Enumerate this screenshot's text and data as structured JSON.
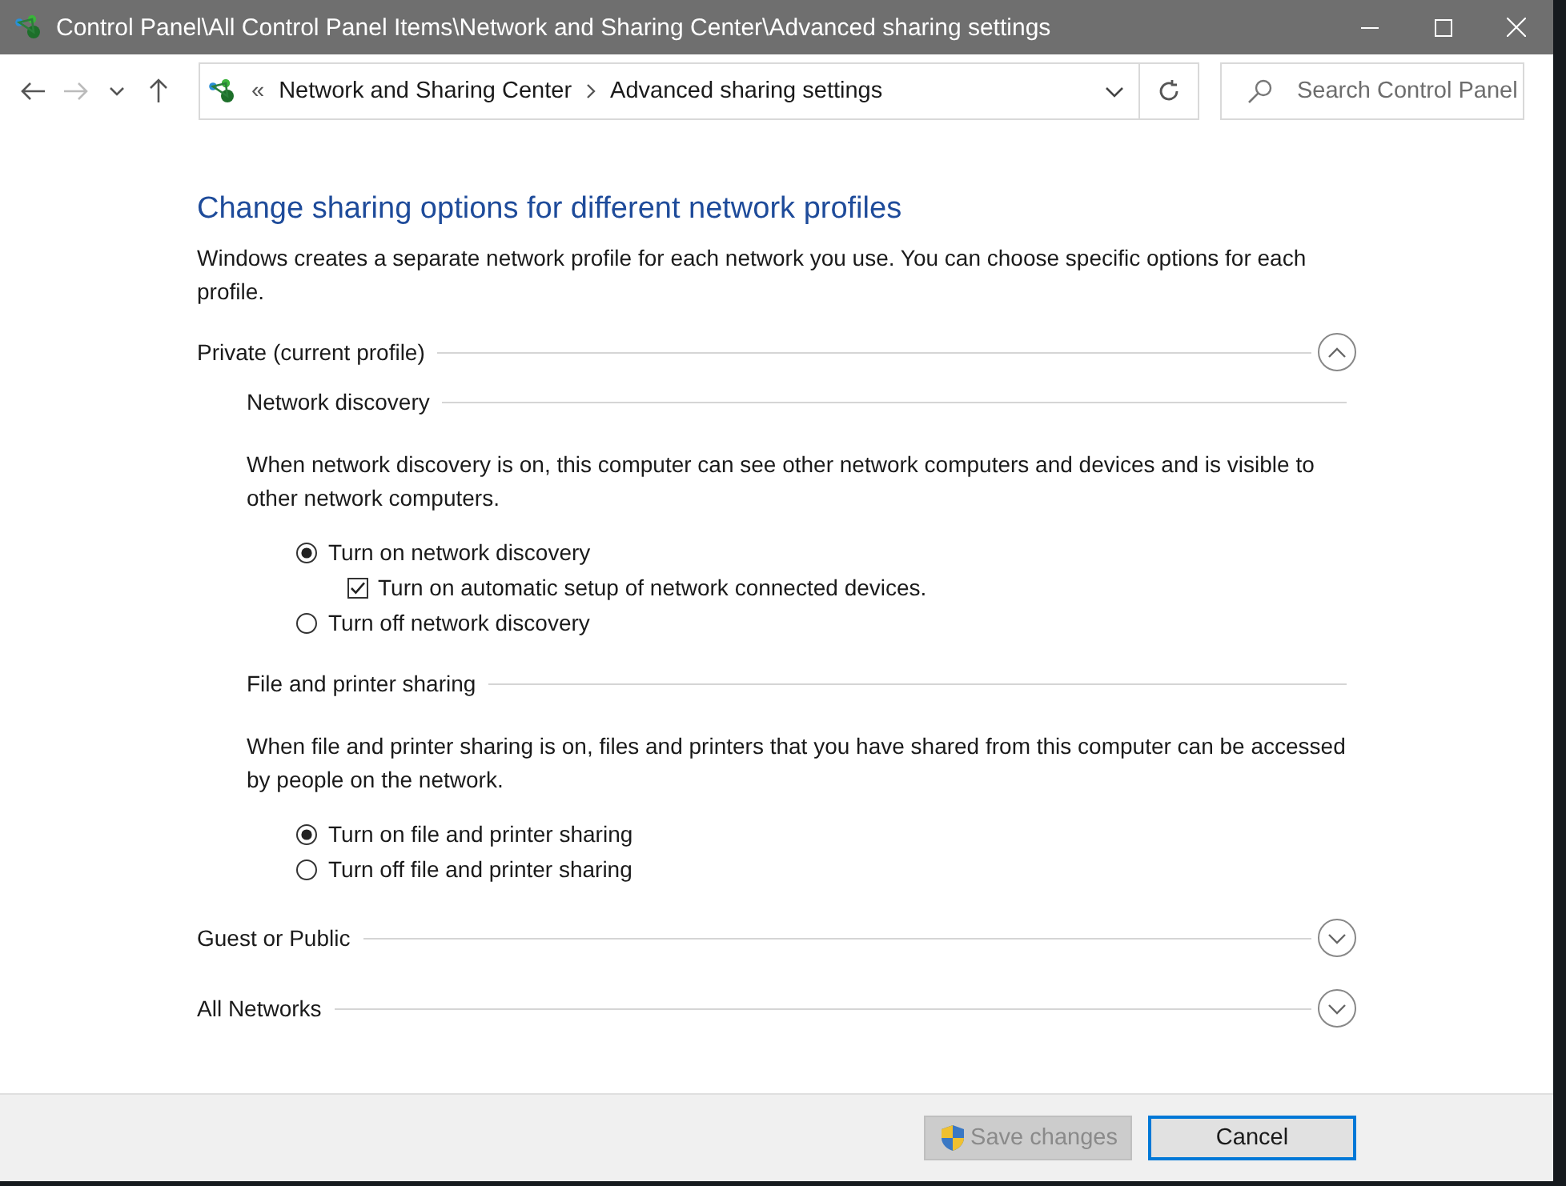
{
  "window": {
    "title": "Control Panel\\All Control Panel Items\\Network and Sharing Center\\Advanced sharing settings"
  },
  "address_bar": {
    "overflow": "«",
    "breadcrumbs": [
      "Network and Sharing Center",
      "Advanced sharing settings"
    ]
  },
  "search": {
    "placeholder": "Search Control Panel"
  },
  "heading": "Change sharing options for different network profiles",
  "intro": "Windows creates a separate network profile for each network you use. You can choose specific options for each profile.",
  "profiles": [
    {
      "name": "Private (current profile)",
      "expanded": true,
      "sections": [
        {
          "title": "Network discovery",
          "description": "When network discovery is on, this computer can see other network computers and devices and is visible to other network computers.",
          "options": [
            {
              "kind": "radio",
              "label": "Turn on network discovery",
              "selected": true
            },
            {
              "kind": "checkbox",
              "label": "Turn on automatic setup of network connected devices.",
              "checked": true
            },
            {
              "kind": "radio",
              "label": "Turn off network discovery",
              "selected": false
            }
          ]
        },
        {
          "title": "File and printer sharing",
          "description": "When file and printer sharing is on, files and printers that you have shared from this computer can be accessed by people on the network.",
          "options": [
            {
              "kind": "radio",
              "label": "Turn on file and printer sharing",
              "selected": true
            },
            {
              "kind": "radio",
              "label": "Turn off file and printer sharing",
              "selected": false
            }
          ]
        }
      ]
    },
    {
      "name": "Guest or Public",
      "expanded": false
    },
    {
      "name": "All Networks",
      "expanded": false
    }
  ],
  "buttons": [
    {
      "kind": "admin",
      "label": "Save changes",
      "disabled": true
    },
    {
      "kind": "plain",
      "label": "Cancel",
      "disabled": false
    }
  ]
}
